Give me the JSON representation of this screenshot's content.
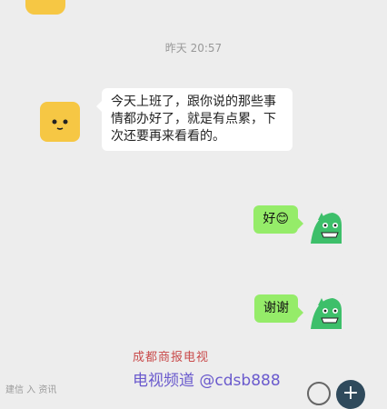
{
  "chat": {
    "timestamp": "昨天 20:57",
    "messages": [
      {
        "side": "in",
        "text": "今天上班了，跟你说的那些事情都办好了，就是有点累，下次还要再来看看的。"
      },
      {
        "side": "out",
        "text": "好😊"
      },
      {
        "side": "out",
        "text": "谢谢"
      }
    ]
  },
  "watermark": {
    "main": "电视频道 @cdsb888",
    "red": "成都商报电视",
    "left": "建信 入 资讯"
  },
  "colors": {
    "background": "#ededed",
    "in_bubble": "#ffffff",
    "out_bubble": "#95ec69",
    "avatar_yellow": "#f6c744",
    "avatar_green": "#3dbf6a"
  }
}
